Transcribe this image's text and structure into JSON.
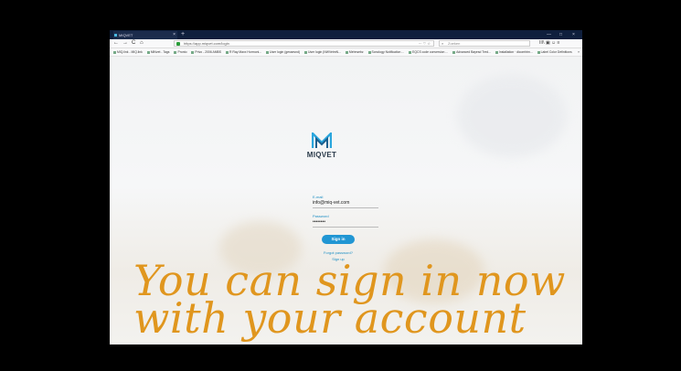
{
  "browser": {
    "tab_title": "MIQVET",
    "tab_close": "×",
    "new_tab": "+",
    "window_controls": [
      "—",
      "□",
      "×"
    ],
    "nav": {
      "back": "←",
      "forward": "→",
      "reload": "C",
      "home": "⌂"
    },
    "url": "https://app.miqvet.com/login",
    "url_actions": "··· ♡ ☆",
    "search_placeholder": "Zoeken",
    "tools": "III\\ ▣ ☺ ≡",
    "bookmarks": [
      "MIQ.link - MIQ.link",
      "MiNvet - Tags",
      "Pronto",
      "Privo - 2006 AMBS",
      "R Ray Maxx Hormoni...",
      "User login (gessesnd)",
      "User login (NWVetmN...",
      "Mehrwebz",
      "Sonology Notification ...",
      "EQCS code conversion ...",
      "Advanced Bayesd Tred...",
      "Installation · dicomhtm...",
      "Label Color Definitions"
    ],
    "bookmarks_more": "»"
  },
  "login": {
    "brand": "MIQVET",
    "email_label": "E-mail",
    "email_value": "info@miq-vet.com",
    "password_label": "Password",
    "password_value": "••••••••",
    "signin_label": "Sign in",
    "forgot_password": "Forgot password?",
    "signup": "Sign up"
  },
  "overlay": {
    "line1": "You can sign in now",
    "line2": "with your account"
  },
  "colors": {
    "accent": "#2196d3",
    "overlay_text": "#e0961e",
    "tab_bar": "#0f1f3d"
  }
}
